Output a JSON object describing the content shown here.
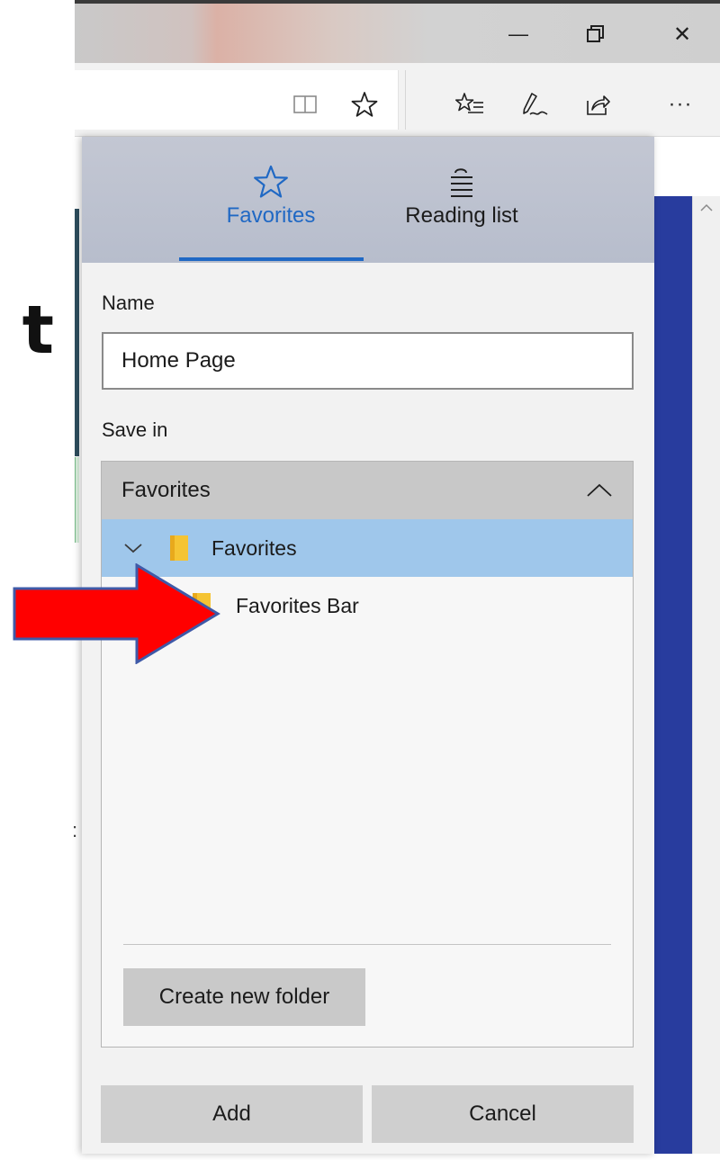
{
  "window": {
    "minimize_glyph": "—",
    "restore_glyph": "⧉",
    "close_glyph": "✕"
  },
  "toolbar": {
    "reading_view_icon": "reading-view-icon",
    "add_favorite_icon": "star-icon",
    "hub_icon": "favorites-hub-icon",
    "notes_icon": "web-note-icon",
    "share_icon": "share-icon",
    "more_label": "···"
  },
  "page": {
    "left_fragment_text": "t",
    "left_stray_text": ":"
  },
  "hub": {
    "tabs": [
      {
        "label": "Favorites",
        "icon": "star-outline-icon",
        "active": true
      },
      {
        "label": "Reading list",
        "icon": "reading-list-icon",
        "active": false
      }
    ],
    "name_label": "Name",
    "name_value": "Home Page",
    "save_in_label": "Save in",
    "location_header": "Favorites",
    "tree": [
      {
        "label": "Favorites",
        "expanded": true,
        "selected": true,
        "level": 0
      },
      {
        "label": "Favorites Bar",
        "expanded": false,
        "selected": false,
        "level": 1
      }
    ],
    "create_folder_label": "Create new folder",
    "add_label": "Add",
    "cancel_label": "Cancel"
  },
  "colors": {
    "accent": "#1f68c4",
    "selection": "#9fc7eb",
    "folder": "#f5c433",
    "page_band": "#283c9e",
    "arrow": "#ff0000"
  }
}
